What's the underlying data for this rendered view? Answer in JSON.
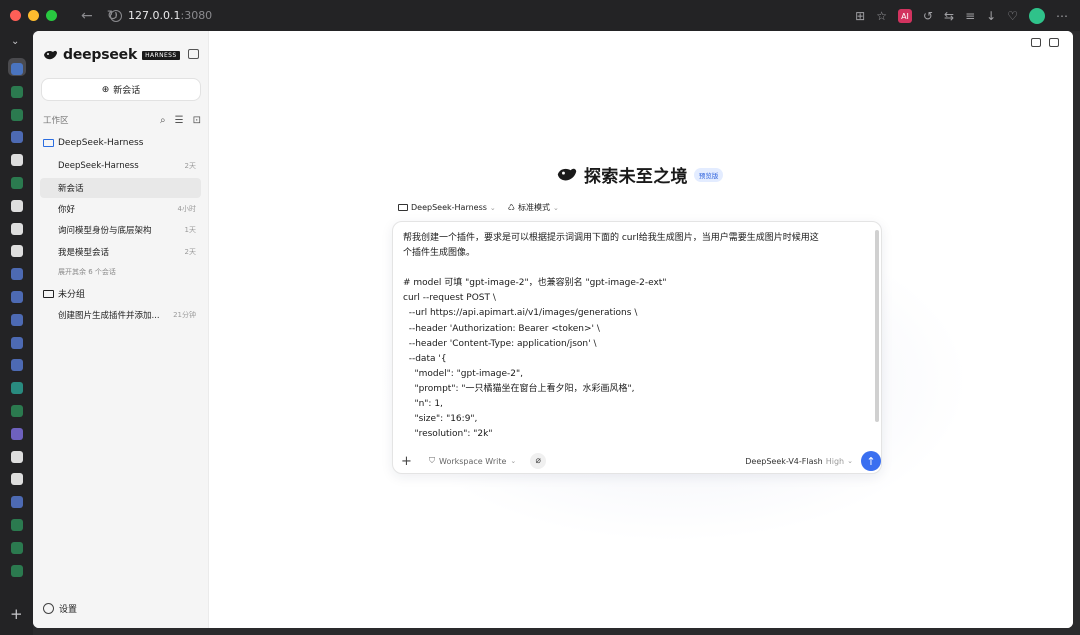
{
  "browser": {
    "url_host": "127.0.0.1",
    "url_port": ":3080",
    "ext_badge": "AI",
    "traffic_colors": [
      "#ff5f57",
      "#febc2e",
      "#28c840"
    ],
    "rail_icon_colors": [
      "#4a7bd4",
      "#2d8a57",
      "#2d8a57",
      "#5577cc",
      "#ffffff",
      "#2d8a57",
      "#ffffff",
      "#ffffff",
      "#ffffff",
      "#5577cc",
      "#5577cc",
      "#5577cc",
      "#5577cc",
      "#5577cc",
      "#2a9d8f",
      "#2d8a57",
      "#7b6cd9",
      "#ffffff",
      "#ffffff",
      "#5577cc",
      "#2d8a57",
      "#2d8a57",
      "#2d8a57"
    ]
  },
  "sidebar": {
    "logo_word": "deepseek",
    "logo_badge": "HARNESS",
    "new_chat_label": "新会话",
    "workspace_label": "工作区",
    "project_folder": "DeepSeek-Harness",
    "conversations": [
      {
        "title": "DeepSeek-Harness",
        "time": "2天"
      },
      {
        "title": "新会话",
        "time": ""
      },
      {
        "title": "你好",
        "time": "4小时"
      },
      {
        "title": "询问模型身份与底层架构",
        "time": "1天"
      },
      {
        "title": "我是模型会话",
        "time": "2天"
      }
    ],
    "more_label": "展开其余 6 个会话",
    "ungrouped_folder": "未分组",
    "ungrouped_conversations": [
      {
        "title": "创建图片生成插件并添加...",
        "time": "21分钟"
      }
    ],
    "settings_label": "设置"
  },
  "main": {
    "hero_title": "探索未至之境",
    "hero_badge": "预览版",
    "project_selector": "DeepSeek-Harness",
    "mode_selector": "标准模式",
    "prompt_text": "帮我创建一个插件，要求是可以根据提示词调用下面的 curl给我生成图片，当用户需要生成图片时候用这\n个插件生成图像。\n\n# model 可填 \"gpt-image-2\"，也兼容别名 \"gpt-image-2-ext\"\ncurl --request POST \\\n  --url https://api.apimart.ai/v1/images/generations \\\n  --header 'Authorization: Bearer <token>' \\\n  --header 'Content-Type: application/json' \\\n  --data '{\n    \"model\": \"gpt-image-2\",\n    \"prompt\": \"一只橘猫坐在窗台上看夕阳，水彩画风格\",\n    \"n\": 1,\n    \"size\": \"16:9\",\n    \"resolution\": \"2k\"",
    "workspace_mode": "Workspace Write",
    "model_name": "DeepSeek-V4-Flash",
    "model_effort": "High",
    "accent_color": "#3a6ff0"
  }
}
